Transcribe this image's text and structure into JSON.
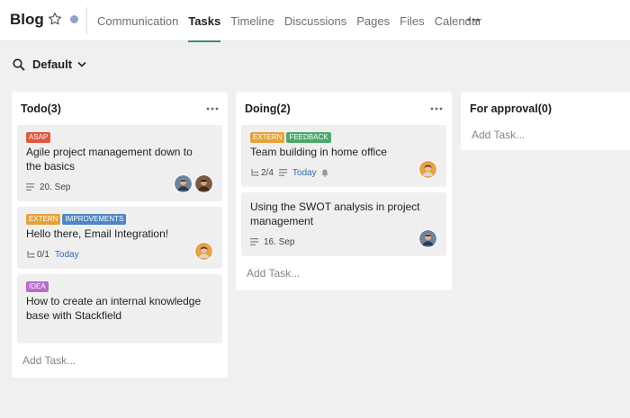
{
  "header": {
    "title": "Blog",
    "tabs": [
      {
        "label": "Communication",
        "active": false
      },
      {
        "label": "Tasks",
        "active": true
      },
      {
        "label": "Timeline",
        "active": false
      },
      {
        "label": "Discussions",
        "active": false
      },
      {
        "label": "Pages",
        "active": false
      },
      {
        "label": "Files",
        "active": false
      },
      {
        "label": "Calendar",
        "active": false
      }
    ]
  },
  "filter": {
    "label": "Default"
  },
  "columns": [
    {
      "title": "Todo(3)",
      "add_label": "Add Task...",
      "cards": [
        {
          "tags": [
            {
              "text": "ASAP",
              "color": "#e0573f"
            }
          ],
          "title": "Agile project management down to the basics",
          "date": "20. Sep"
        },
        {
          "tags": [
            {
              "text": "EXTERN",
              "color": "#e5a13a"
            },
            {
              "text": "IMPROVEMENTS",
              "color": "#4f86c6"
            }
          ],
          "title": "Hello there, Email Integration!",
          "subtasks": "0/1",
          "due": "Today"
        },
        {
          "tags": [
            {
              "text": "IDEA",
              "color": "#b86cc8"
            }
          ],
          "title": "How to create an internal knowledge base with Stackfield"
        }
      ]
    },
    {
      "title": "Doing(2)",
      "add_label": "Add Task...",
      "cards": [
        {
          "tags": [
            {
              "text": "EXTERN",
              "color": "#e5a13a"
            },
            {
              "text": "FEEDBACK",
              "color": "#4aa96c"
            }
          ],
          "title": "Team building in home office",
          "subtasks": "2/4",
          "due": "Today"
        },
        {
          "tags": [],
          "title": "Using the SWOT analysis in project management",
          "date": "16. Sep"
        }
      ]
    },
    {
      "title": "For approval(0)",
      "add_label": "Add Task..."
    }
  ]
}
